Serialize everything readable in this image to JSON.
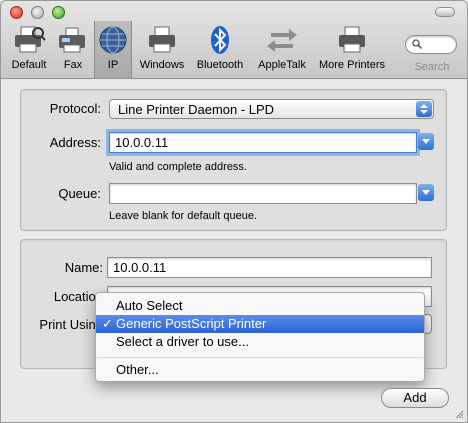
{
  "toolbar": {
    "items": [
      {
        "label": "Default",
        "icon": "printer-icon"
      },
      {
        "label": "Fax",
        "icon": "fax-icon"
      },
      {
        "label": "IP",
        "icon": "globe-icon"
      },
      {
        "label": "Windows",
        "icon": "printer-icon"
      },
      {
        "label": "Bluetooth",
        "icon": "bluetooth-icon"
      },
      {
        "label": "AppleTalk",
        "icon": "appletalk-icon"
      },
      {
        "label": "More Printers",
        "icon": "printer-icon"
      }
    ],
    "selected": "IP",
    "search_label": "Search"
  },
  "ip_group": {
    "protocol_label": "Protocol:",
    "protocol_value": "Line Printer Daemon - LPD",
    "address_label": "Address:",
    "address_value": "10.0.0.11",
    "address_hint": "Valid and complete address.",
    "queue_label": "Queue:",
    "queue_value": "",
    "queue_hint": "Leave blank for default queue."
  },
  "info_group": {
    "name_label": "Name:",
    "name_value": "10.0.0.11",
    "location_label": "Location",
    "print_using_label": "Print Using"
  },
  "print_using_menu": {
    "items": [
      "Auto Select",
      "Generic PostScript Printer",
      "Select a driver to use...",
      "Other..."
    ],
    "selected": "Generic PostScript Printer",
    "check_glyph": "✓"
  },
  "buttons": {
    "add_label": "Add"
  },
  "colors": {
    "accent": "#2a62d6",
    "focus_ring": "#8cb6e6"
  }
}
